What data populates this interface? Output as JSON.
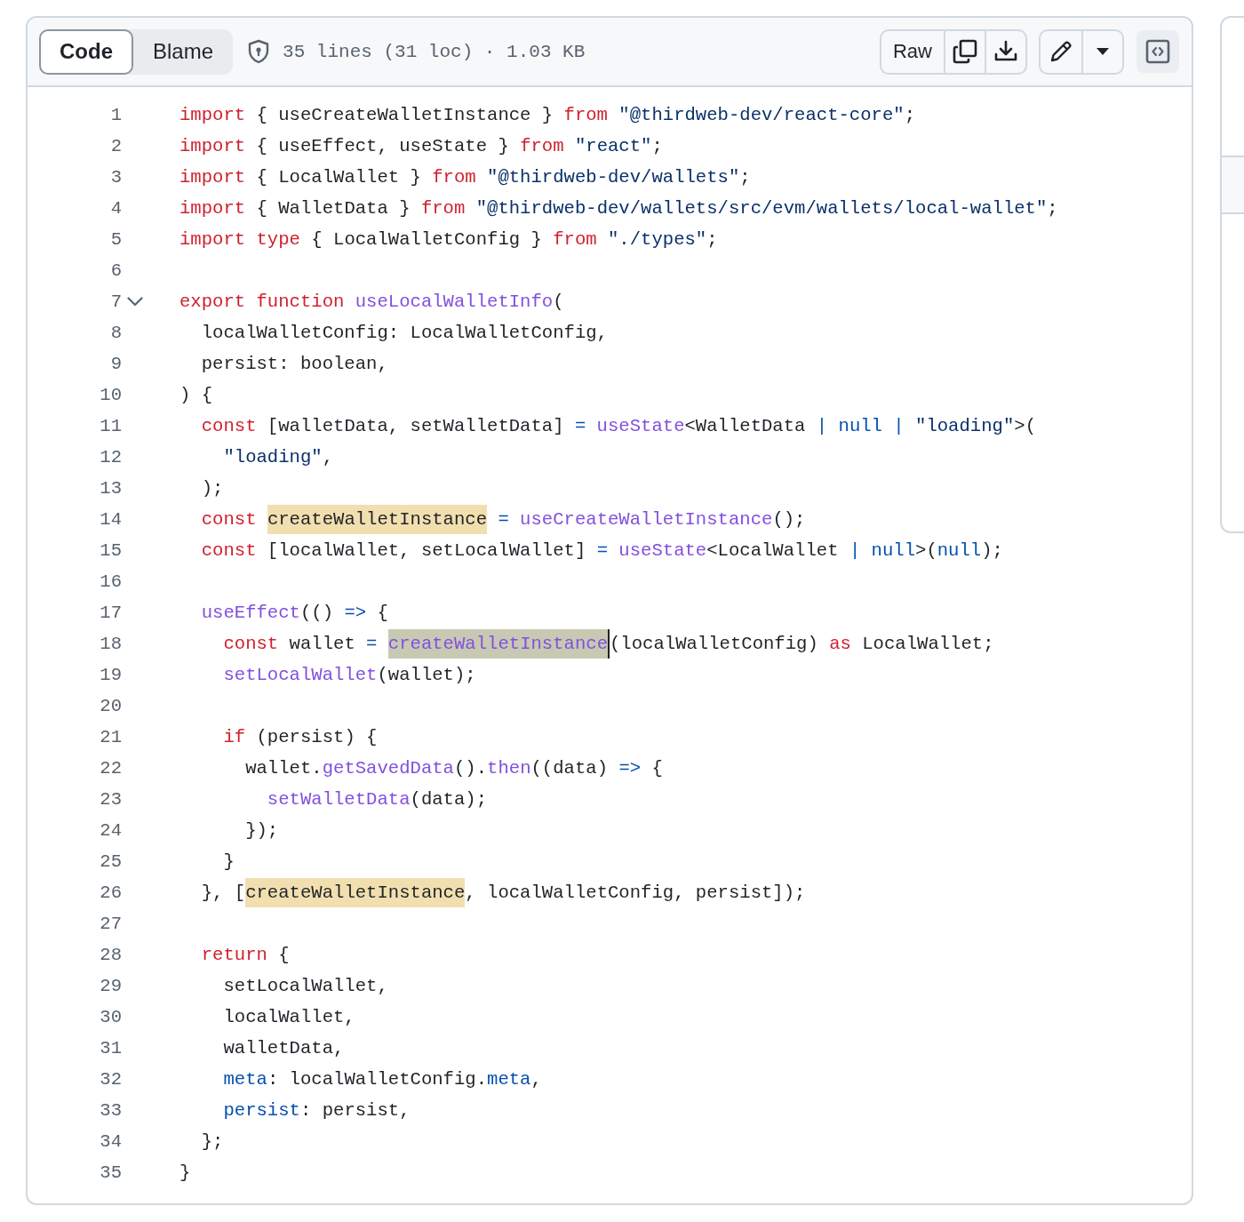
{
  "toolbar": {
    "tabs": [
      {
        "label": "Code",
        "selected": true
      },
      {
        "label": "Blame",
        "selected": false
      }
    ],
    "file_info": "35 lines (31 loc) · 1.03 KB",
    "raw_button": "Raw"
  },
  "lines": [
    {
      "number": "1",
      "tokens": [
        {
          "text": "import",
          "kind": "keyword"
        },
        {
          "text": " { useCreateWalletInstance } ",
          "kind": "plain"
        },
        {
          "text": "from",
          "kind": "keyword"
        },
        {
          "text": " \"@thirdweb-dev/react-core\"",
          "kind": "string"
        },
        {
          "text": ";",
          "kind": "plain"
        }
      ]
    },
    {
      "number": "2",
      "tokens": [
        {
          "text": "import",
          "kind": "keyword"
        },
        {
          "text": " { useEffect, useState } ",
          "kind": "plain"
        },
        {
          "text": "from",
          "kind": "keyword"
        },
        {
          "text": " \"react\"",
          "kind": "string"
        },
        {
          "text": ";",
          "kind": "plain"
        }
      ]
    },
    {
      "number": "3",
      "tokens": [
        {
          "text": "import",
          "kind": "keyword"
        },
        {
          "text": " { LocalWallet } ",
          "kind": "plain"
        },
        {
          "text": "from",
          "kind": "keyword"
        },
        {
          "text": " \"@thirdweb-dev/wallets\"",
          "kind": "string"
        },
        {
          "text": ";",
          "kind": "plain"
        }
      ]
    },
    {
      "number": "4",
      "tokens": [
        {
          "text": "import",
          "kind": "keyword"
        },
        {
          "text": " { WalletData } ",
          "kind": "plain"
        },
        {
          "text": "from",
          "kind": "keyword"
        },
        {
          "text": " \"@thirdweb-dev/wallets/src/evm/wallets/local-wallet\"",
          "kind": "string"
        },
        {
          "text": ";",
          "kind": "plain"
        }
      ]
    },
    {
      "number": "5",
      "tokens": [
        {
          "text": "import",
          "kind": "keyword"
        },
        {
          "text": " type",
          "kind": "keyword"
        },
        {
          "text": " { LocalWalletConfig } ",
          "kind": "plain"
        },
        {
          "text": "from",
          "kind": "keyword"
        },
        {
          "text": " \"./types\"",
          "kind": "string"
        },
        {
          "text": ";",
          "kind": "plain"
        }
      ]
    },
    {
      "number": "6"
    },
    {
      "number": "7",
      "fold": {
        "expanded": true
      },
      "tokens": [
        {
          "text": "export",
          "kind": "keyword"
        },
        {
          "text": " function",
          "kind": "keyword"
        },
        {
          "text": " useLocalWalletInfo",
          "kind": "function"
        },
        {
          "text": "(",
          "kind": "plain"
        }
      ]
    },
    {
      "number": "8",
      "tokens": [
        {
          "text": "  localWalletConfig: LocalWalletConfig,",
          "kind": "plain"
        }
      ]
    },
    {
      "number": "9",
      "tokens": [
        {
          "text": "  persist: boolean,",
          "kind": "plain"
        }
      ]
    },
    {
      "number": "10",
      "tokens": [
        {
          "text": ") {",
          "kind": "plain"
        }
      ]
    },
    {
      "number": "11",
      "tokens": [
        {
          "text": "  const",
          "kind": "keyword"
        },
        {
          "text": " [walletData, setWalletData] ",
          "kind": "plain"
        },
        {
          "text": "=",
          "kind": "constant"
        },
        {
          "text": " useState",
          "kind": "function"
        },
        {
          "text": "<WalletData ",
          "kind": "plain"
        },
        {
          "text": "| null |",
          "kind": "constant"
        },
        {
          "text": " \"loading\"",
          "kind": "string"
        },
        {
          "text": ">(",
          "kind": "plain"
        }
      ]
    },
    {
      "number": "12",
      "tokens": [
        {
          "text": "    \"loading\"",
          "kind": "string"
        },
        {
          "text": ",",
          "kind": "plain"
        }
      ]
    },
    {
      "number": "13",
      "tokens": [
        {
          "text": "  );",
          "kind": "plain"
        }
      ]
    },
    {
      "number": "14",
      "tokens": [
        {
          "text": "  const ",
          "kind": "keyword"
        },
        {
          "text": "createWalletInstance",
          "kind": "plain",
          "highlighted": true
        },
        {
          "text": " =",
          "kind": "constant"
        },
        {
          "text": " useCreateWalletInstance",
          "kind": "function"
        },
        {
          "text": "();",
          "kind": "plain"
        }
      ]
    },
    {
      "number": "15",
      "tokens": [
        {
          "text": "  const",
          "kind": "keyword"
        },
        {
          "text": " [localWallet, setLocalWallet] ",
          "kind": "plain"
        },
        {
          "text": "=",
          "kind": "constant"
        },
        {
          "text": " useState",
          "kind": "function"
        },
        {
          "text": "<LocalWallet ",
          "kind": "plain"
        },
        {
          "text": "| null",
          "kind": "constant"
        },
        {
          "text": ">(",
          "kind": "plain"
        },
        {
          "text": "null",
          "kind": "constant"
        },
        {
          "text": ");",
          "kind": "plain"
        }
      ]
    },
    {
      "number": "16"
    },
    {
      "number": "17",
      "tokens": [
        {
          "text": "  useEffect",
          "kind": "function"
        },
        {
          "text": "(() ",
          "kind": "plain"
        },
        {
          "text": "=>",
          "kind": "constant"
        },
        {
          "text": " {",
          "kind": "plain"
        }
      ]
    },
    {
      "number": "18",
      "tokens": [
        {
          "text": "    const",
          "kind": "keyword"
        },
        {
          "text": " wallet ",
          "kind": "plain"
        },
        {
          "text": "= ",
          "kind": "constant"
        },
        {
          "text": "createWalletInstance",
          "kind": "function",
          "highlighted": true,
          "cursor": true
        },
        {
          "text": "(localWalletConfig) ",
          "kind": "plain"
        },
        {
          "text": "as",
          "kind": "keyword"
        },
        {
          "text": " LocalWallet;",
          "kind": "plain"
        }
      ]
    },
    {
      "number": "19",
      "tokens": [
        {
          "text": "    setLocalWallet",
          "kind": "function"
        },
        {
          "text": "(wallet);",
          "kind": "plain"
        }
      ]
    },
    {
      "number": "20"
    },
    {
      "number": "21",
      "tokens": [
        {
          "text": "    if",
          "kind": "keyword"
        },
        {
          "text": " (persist) {",
          "kind": "plain"
        }
      ]
    },
    {
      "number": "22",
      "tokens": [
        {
          "text": "      wallet.",
          "kind": "plain"
        },
        {
          "text": "getSavedData",
          "kind": "function"
        },
        {
          "text": "().",
          "kind": "plain"
        },
        {
          "text": "then",
          "kind": "function"
        },
        {
          "text": "((data) ",
          "kind": "plain"
        },
        {
          "text": "=>",
          "kind": "constant"
        },
        {
          "text": " {",
          "kind": "plain"
        }
      ]
    },
    {
      "number": "23",
      "tokens": [
        {
          "text": "        setWalletData",
          "kind": "function"
        },
        {
          "text": "(data);",
          "kind": "plain"
        }
      ]
    },
    {
      "number": "24",
      "tokens": [
        {
          "text": "      });",
          "kind": "plain"
        }
      ]
    },
    {
      "number": "25",
      "tokens": [
        {
          "text": "    }",
          "kind": "plain"
        }
      ]
    },
    {
      "number": "26",
      "tokens": [
        {
          "text": "  }, [",
          "kind": "plain"
        },
        {
          "text": "createWalletInstance",
          "kind": "plain",
          "highlighted": true
        },
        {
          "text": ", localWalletConfig, persist]);",
          "kind": "plain"
        }
      ]
    },
    {
      "number": "27"
    },
    {
      "number": "28",
      "tokens": [
        {
          "text": "  return",
          "kind": "keyword"
        },
        {
          "text": " {",
          "kind": "plain"
        }
      ]
    },
    {
      "number": "29",
      "tokens": [
        {
          "text": "    setLocalWallet,",
          "kind": "plain"
        }
      ]
    },
    {
      "number": "30",
      "tokens": [
        {
          "text": "    localWallet,",
          "kind": "plain"
        }
      ]
    },
    {
      "number": "31",
      "tokens": [
        {
          "text": "    walletData,",
          "kind": "plain"
        }
      ]
    },
    {
      "number": "32",
      "tokens": [
        {
          "text": "    meta",
          "kind": "constant"
        },
        {
          "text": ": localWalletConfig.",
          "kind": "plain"
        },
        {
          "text": "meta",
          "kind": "constant"
        },
        {
          "text": ",",
          "kind": "plain"
        }
      ]
    },
    {
      "number": "33",
      "tokens": [
        {
          "text": "    persist",
          "kind": "constant"
        },
        {
          "text": ": persist,",
          "kind": "plain"
        }
      ]
    },
    {
      "number": "34",
      "tokens": [
        {
          "text": "  };",
          "kind": "plain"
        }
      ]
    },
    {
      "number": "35",
      "tokens": [
        {
          "text": "}",
          "kind": "plain"
        }
      ]
    }
  ]
}
